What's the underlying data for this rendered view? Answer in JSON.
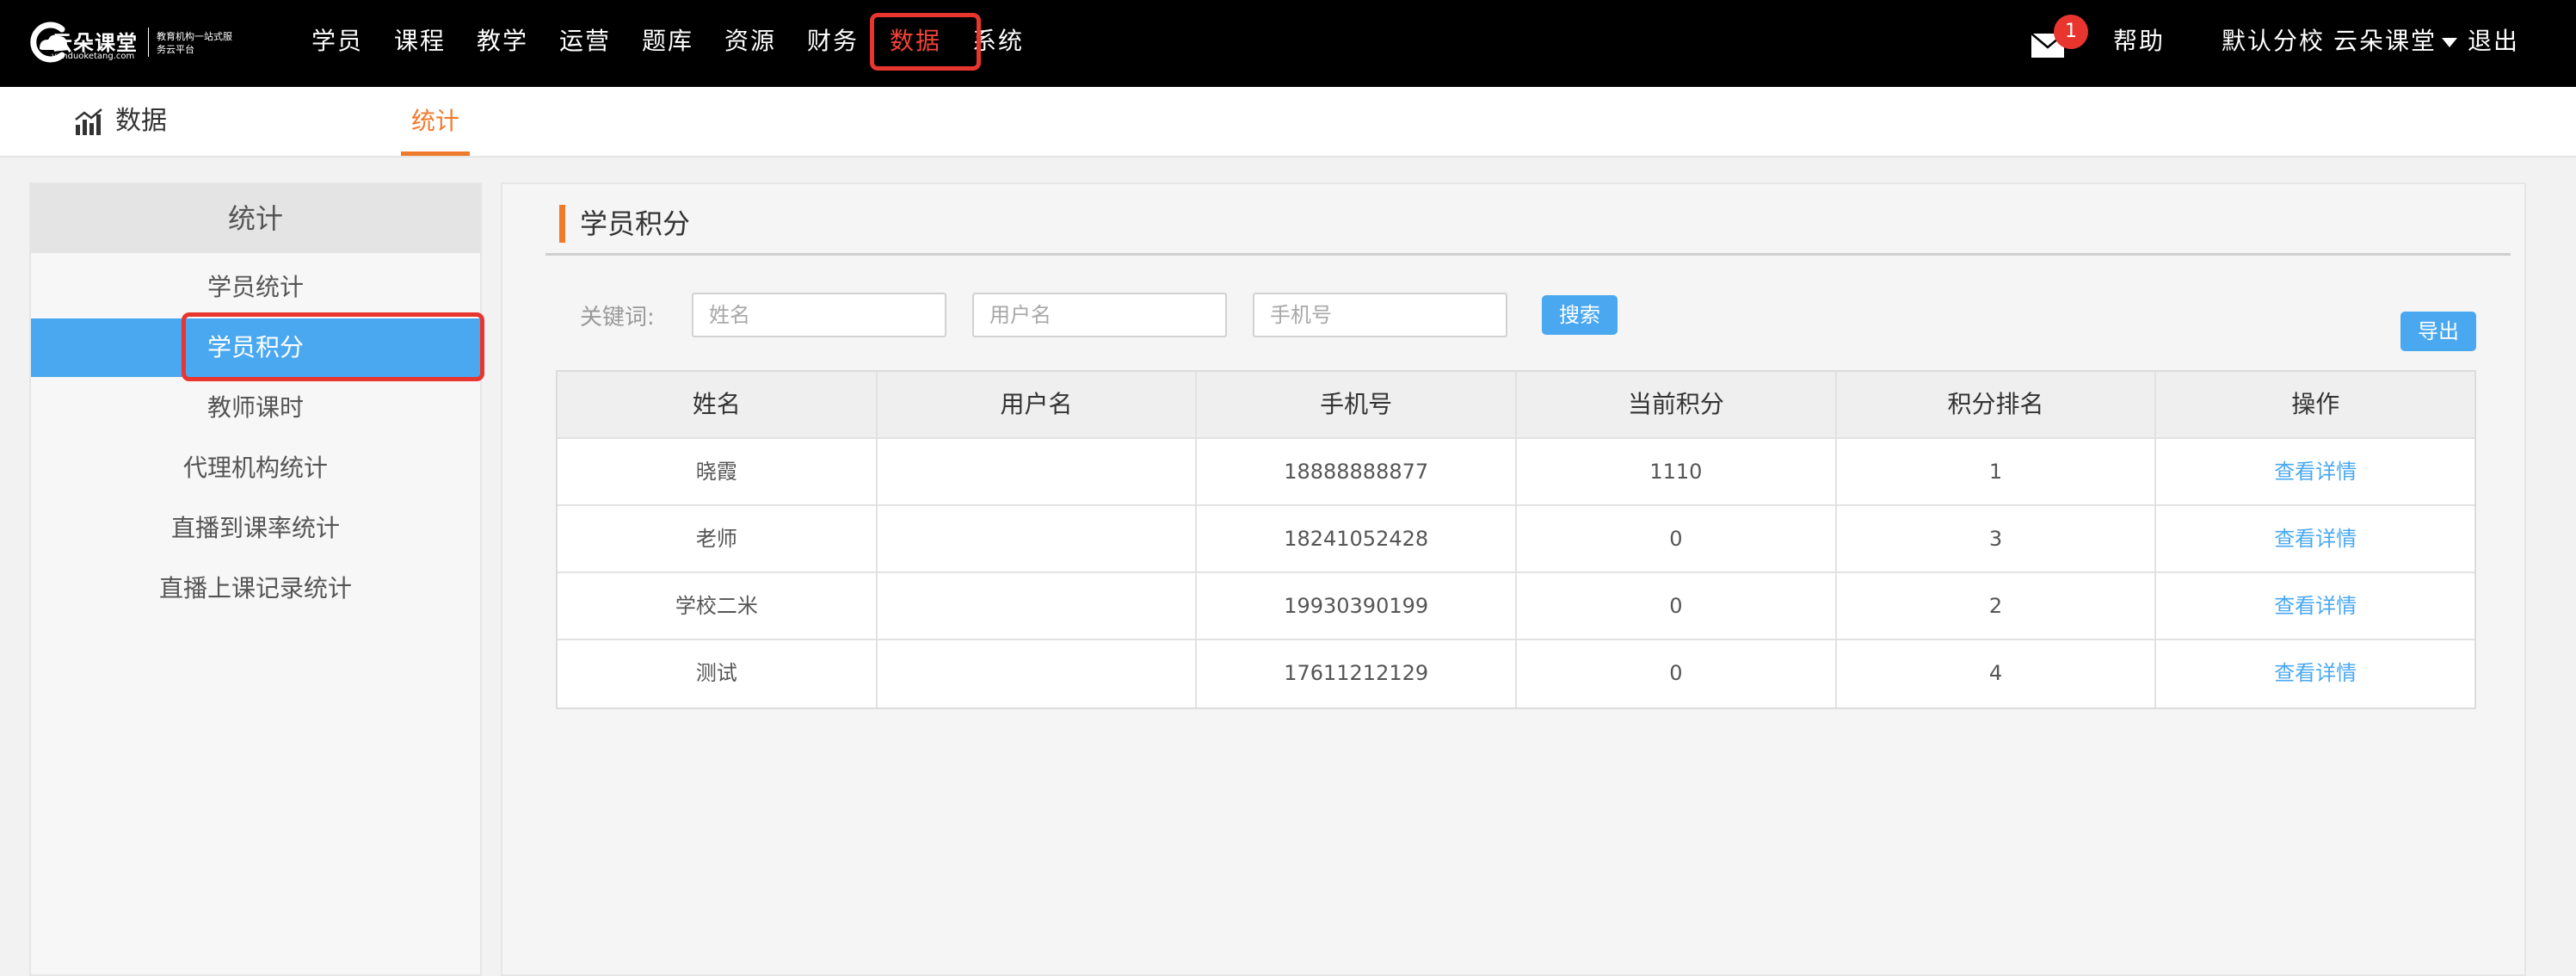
{
  "logo": {
    "title": "云朵课堂",
    "url": "yunduoketang.com",
    "slogan": "教育机构一站式服务云平台"
  },
  "nav": {
    "items": [
      "学员",
      "课程",
      "教学",
      "运营",
      "题库",
      "资源",
      "财务",
      "数据",
      "系统"
    ],
    "active": "数据"
  },
  "topright": {
    "mail_icon": "envelope-icon",
    "unread_count": "1",
    "help": "帮助",
    "school": "默认分校",
    "user": "云朵课堂",
    "logout": "退出"
  },
  "subheader": {
    "icon": "bar-chart-icon",
    "title": "数据",
    "tab": "统计"
  },
  "sidebar": {
    "heading": "统计",
    "items": [
      "学员统计",
      "学员积分",
      "教师课时",
      "代理机构统计",
      "直播到课率统计",
      "直播上课记录统计"
    ],
    "active": "学员积分"
  },
  "main": {
    "title": "学员积分",
    "keyword_label": "关键词:",
    "placeholders": {
      "name": "姓名",
      "username": "用户名",
      "phone": "手机号"
    },
    "search_button": "搜索",
    "export_button": "导出"
  },
  "table": {
    "headers": [
      "姓名",
      "用户名",
      "手机号",
      "当前积分",
      "积分排名",
      "操作"
    ],
    "rows": [
      {
        "name": "晓霞",
        "username": "",
        "phone": "18888888877",
        "points": "1110",
        "rank": "1",
        "action": "查看详情"
      },
      {
        "name": "老师",
        "username": "",
        "phone": "18241052428",
        "points": "0",
        "rank": "3",
        "action": "查看详情"
      },
      {
        "name": "学校二米",
        "username": "",
        "phone": "19930390199",
        "points": "0",
        "rank": "2",
        "action": "查看详情"
      },
      {
        "name": "测试",
        "username": "",
        "phone": "17611212129",
        "points": "0",
        "rank": "4",
        "action": "查看详情"
      }
    ]
  },
  "colors": {
    "topbar": "#000000",
    "accent_orange": "#f07a2b",
    "accent_blue": "#4aa8f1",
    "highlight_red": "#e8362f"
  }
}
